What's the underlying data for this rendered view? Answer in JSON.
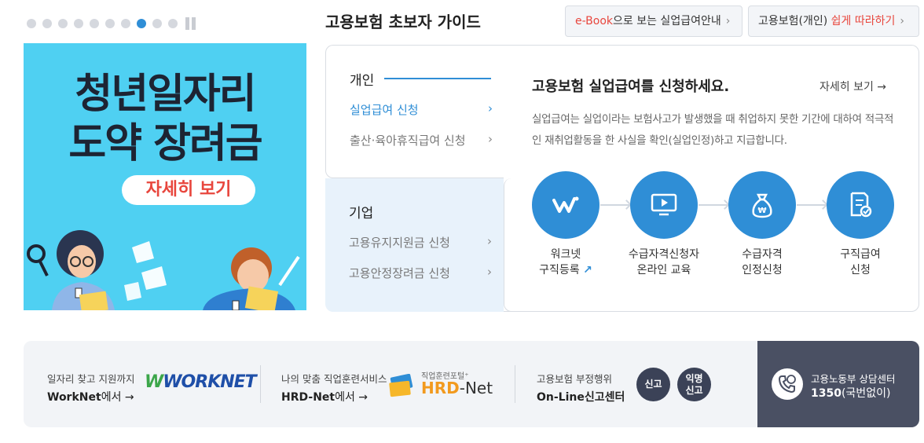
{
  "carousel": {
    "dot_count": 10,
    "active_index": 7
  },
  "banner": {
    "title_line1": "청년일자리",
    "title_line2": "도약 장려금",
    "button": "자세히 보기"
  },
  "guide": {
    "title": "고용보험 초보자 가이드",
    "ebook_btn": {
      "accent": "e-Book",
      "rest": "으로 보는 실업급여안내",
      "chev": "›"
    },
    "easy_btn": {
      "prefix": "고용보험(개인) ",
      "accent": "쉽게 따라하기",
      "chev": "›"
    }
  },
  "menu": {
    "personal": {
      "heading": "개인",
      "items": [
        {
          "label": "실업급여 신청",
          "chev": "›"
        },
        {
          "label": "출산·육아휴직급여 신청",
          "chev": "›"
        }
      ]
    },
    "corporate": {
      "heading": "기업",
      "items": [
        {
          "label": "고용유지지원금 신청",
          "chev": "›"
        },
        {
          "label": "고용안정장려금 신청",
          "chev": "›"
        }
      ]
    }
  },
  "panel": {
    "title": "고용보험 실업급여를 신청하세요.",
    "more": "자세히 보기 →",
    "desc": "실업급여는 실업이라는 보험사고가 발생했을 때 취업하지 못한 기간에 대하여 적극적인 재취업활동을 한 사실을 확인(실업인정)하고 지급합니다.",
    "steps": [
      {
        "line1": "워크넷",
        "line2": "구직등록",
        "icon": "worknet-logo-icon"
      },
      {
        "line1": "수급자격신청자",
        "line2": "온라인 교육",
        "icon": "monitor-play-icon"
      },
      {
        "line1": "수급자격",
        "line2": "인정신청",
        "icon": "money-bag-icon"
      },
      {
        "line1": "구직급여",
        "line2": "신청",
        "icon": "document-check-icon"
      }
    ]
  },
  "bottom": {
    "worknet": {
      "small": "일자리 찾고 지원까지",
      "big": "WorkNet",
      "big_suffix": "에서 →",
      "logo": "WORKNET"
    },
    "hrd": {
      "small": "나의 맞춤 직업훈련서비스",
      "big": "HRD-Net",
      "big_suffix": "에서 →",
      "logo_small": "직업훈련포털⁺",
      "logo_hrd": "HRD",
      "logo_net": "-Net"
    },
    "report": {
      "small": "고용보험 부정행위",
      "big": "On-Line신고센터",
      "btn1": "신고",
      "btn2_l1": "익명",
      "btn2_l2": "신고"
    },
    "call": {
      "small": "고용노동부 상담센터",
      "big": "1350",
      "big_suffix": "(국번없이)"
    }
  },
  "colors": {
    "accent": "#2f8ed6",
    "red": "#e8463d",
    "banner_bg": "#4fd0f2",
    "dark": "#4a5063"
  }
}
